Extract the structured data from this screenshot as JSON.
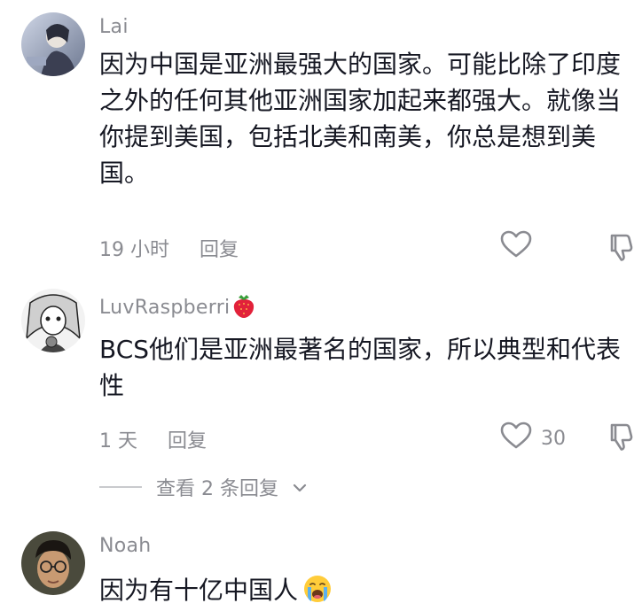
{
  "comments": [
    {
      "author": "Lai",
      "text": "因为中国是亚洲最强大的国家。可能比除了印度之外的任何其他亚洲国家加起来都强大。就像当你提到美国，包括北美和南美，你总是想到美国。",
      "time": "19 小时",
      "reply_label": "回复",
      "like_count": "",
      "icons": [
        "heart-icon",
        "thumb-down-icon"
      ]
    },
    {
      "author": "LuvRaspberri",
      "author_emoji": "strawberry",
      "text": "BCS他们是亚洲最著名的国家，所以典型和代表性",
      "time": "1 天",
      "reply_label": "回复",
      "like_count": "30",
      "icons": [
        "heart-icon",
        "thumb-down-icon"
      ],
      "view_replies": "查看 2 条回复"
    },
    {
      "author": "Noah",
      "text": "因为有十亿中国人",
      "text_emoji": "loudly-crying-face"
    }
  ],
  "colors": {
    "primary_text": "#161823",
    "secondary_text": "#8a8b91",
    "background": "#ffffff"
  }
}
